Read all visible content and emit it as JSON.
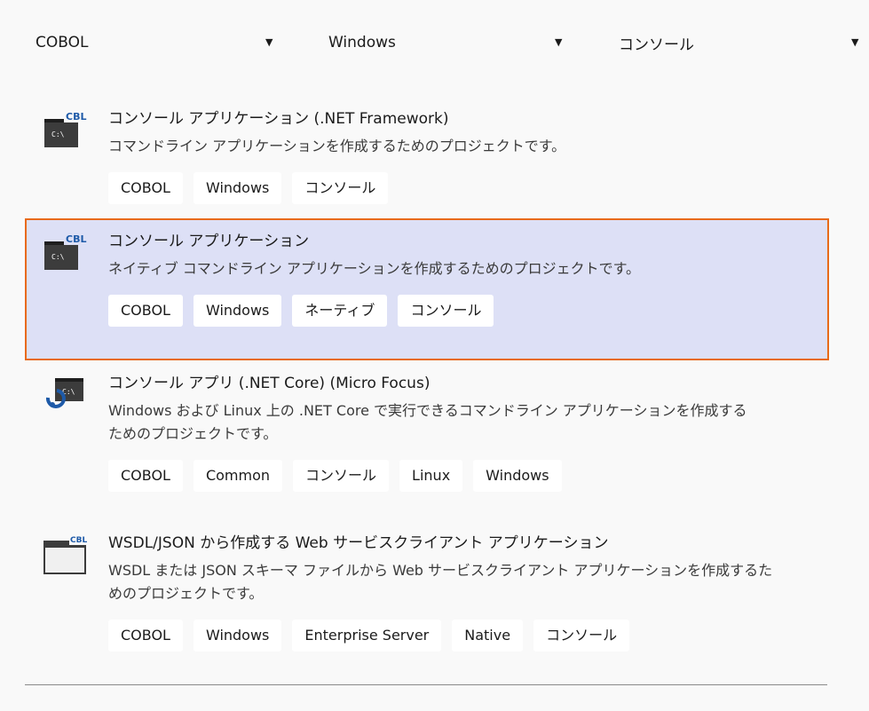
{
  "filters": {
    "language": "COBOL",
    "platform": "Windows",
    "project_type": "コンソール",
    "arrow": "▼"
  },
  "templates": [
    {
      "title": "コンソール アプリケーション (.NET Framework)",
      "description": "コマンドライン アプリケーションを作成するためのプロジェクトです。",
      "tags": [
        "COBOL",
        "Windows",
        "コンソール"
      ],
      "icon": "cbl-console-icon",
      "icon_text": "CBL",
      "icon_prompt": "C:\\",
      "selected": false
    },
    {
      "title": "コンソール アプリケーション",
      "description": "ネイティブ コマンドライン アプリケーションを作成するためのプロジェクトです。",
      "tags": [
        "COBOL",
        "Windows",
        "ネーティブ",
        "コンソール"
      ],
      "icon": "cbl-console-icon",
      "icon_text": "CBL",
      "icon_prompt": "C:\\",
      "selected": true
    },
    {
      "title": "コンソール アプリ (.NET Core) (Micro Focus)",
      "description_line1": "Windows および Linux 上の .NET Core で実行できるコマンドライン アプリケーションを作成する",
      "description_line2": "ためのプロジェクトです。",
      "tags": [
        "COBOL",
        "Common",
        "コンソール",
        "Linux",
        "Windows"
      ],
      "icon": "netcore-console-icon",
      "icon_prompt": "C:\\",
      "selected": false
    },
    {
      "title": "WSDL/JSON から作成する Web サービスクライアント アプリケーション",
      "description_line1": "WSDL または JSON スキーマ ファイルから Web サービスクライアント アプリケーションを作成するた",
      "description_line2": "めのプロジェクトです。",
      "tags": [
        "COBOL",
        "Windows",
        "Enterprise Server",
        "Native",
        "コンソール"
      ],
      "icon": "cbl-window-icon",
      "icon_text": "CBL",
      "selected": false
    }
  ],
  "colors": {
    "background": "#f9f9f9",
    "selected_background": "#dde0f6",
    "selected_border": "#e86a19",
    "tag_background": "#ffffff"
  }
}
